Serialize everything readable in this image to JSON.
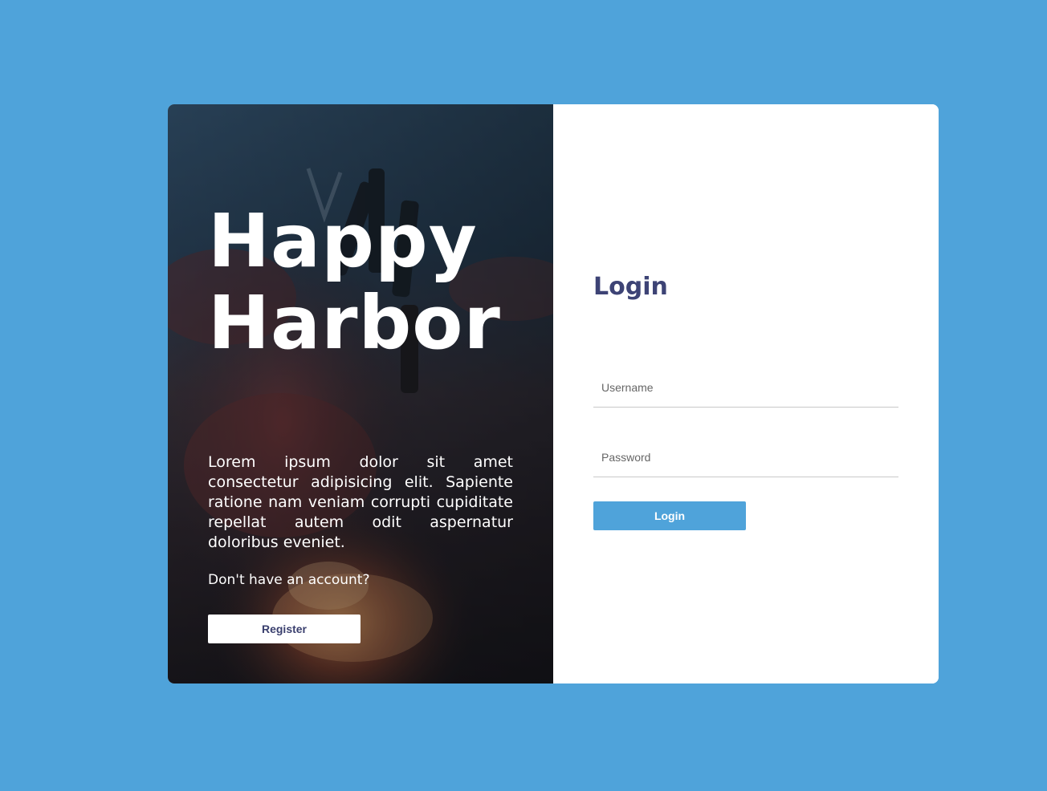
{
  "colors": {
    "page_background": "#4fa3da",
    "accent": "#4fa3da",
    "heading": "#3d4375",
    "card": "#ffffff"
  },
  "hero": {
    "image": "friends-toasting-bottles-campfire-photo",
    "brand_line1": "Happy",
    "brand_line2": "Harbor",
    "blurb": "Lorem ipsum dolor sit amet consectetur adipisicing elit. Sapiente ratione nam veniam corrupti cupiditate repellat autem odit aspernatur doloribus eveniet.",
    "signup_prompt": "Don't have an account?",
    "register_label": "Register"
  },
  "login": {
    "title": "Login",
    "username_placeholder": "Username",
    "password_placeholder": "Password",
    "submit_label": "Login"
  }
}
